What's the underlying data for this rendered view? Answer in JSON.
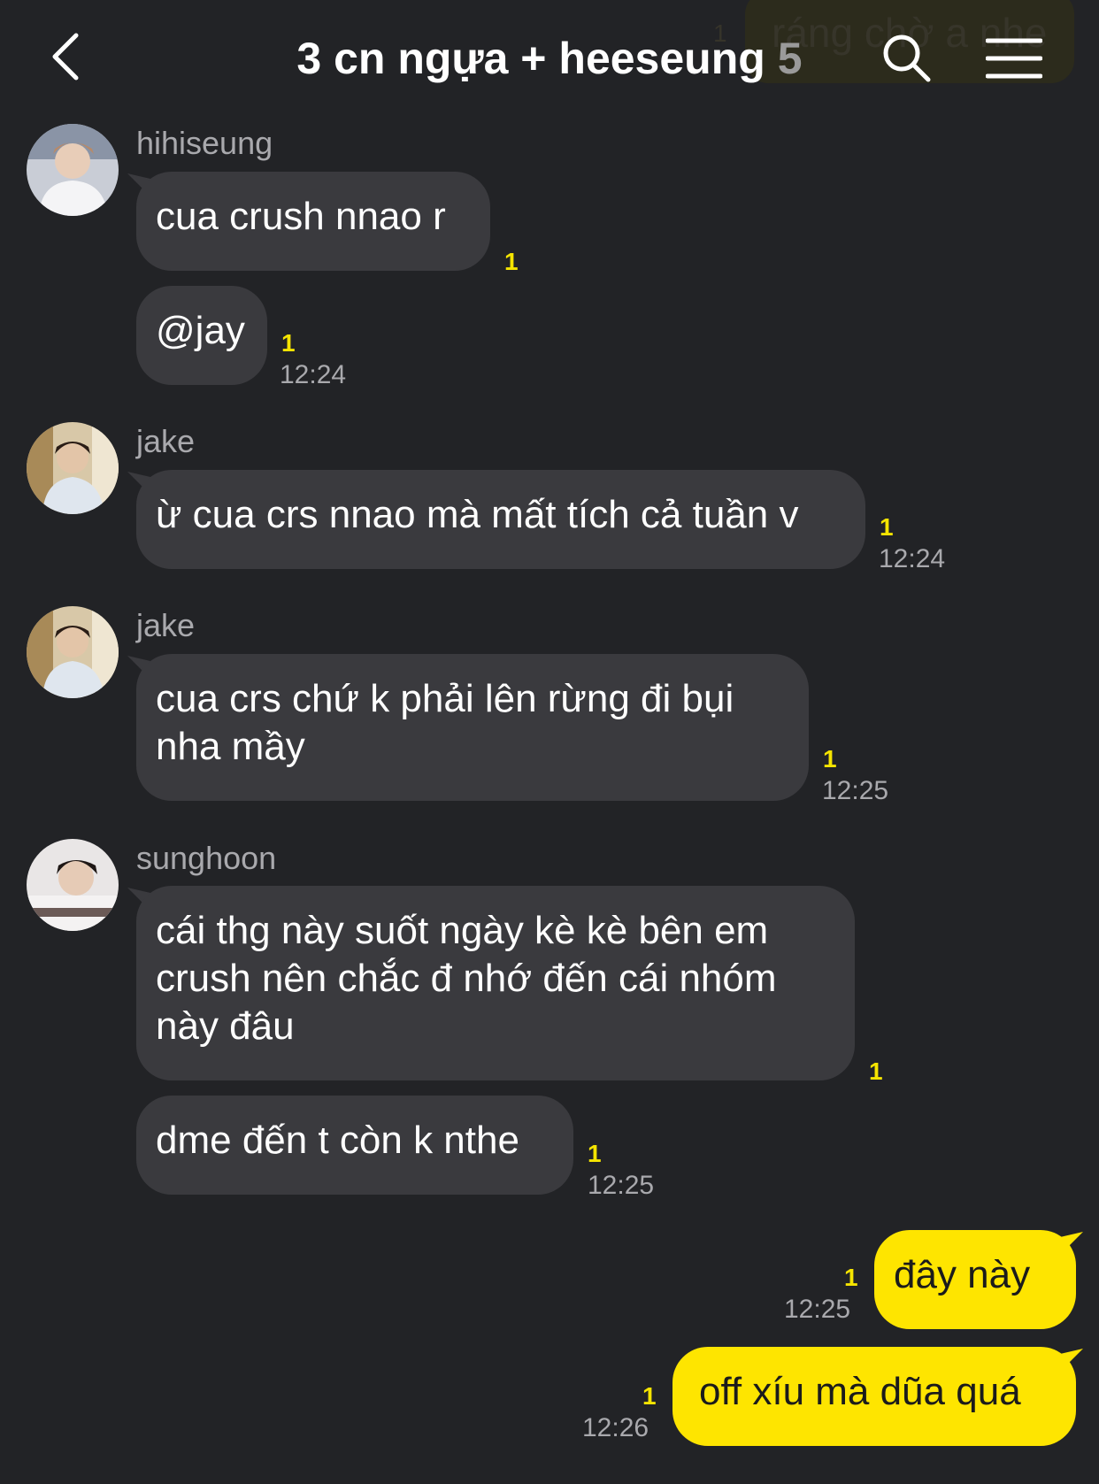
{
  "header": {
    "title": "3 cn ngựa + heeseung",
    "member_count": "5",
    "back_icon": "chevron-left-icon",
    "search_icon": "search-icon",
    "menu_icon": "hamburger-menu-icon"
  },
  "previous_message": {
    "text": "ráng chờ a nhe",
    "unread": "1"
  },
  "colors": {
    "background": "#222326",
    "bubble_other": "#3a3a3e",
    "bubble_mine": "#fee500",
    "unread": "#f5e400",
    "meta_text": "#a9a9ad"
  },
  "messages": [
    {
      "sender": "hihiseung",
      "bubbles": [
        {
          "text": "cua crush nnao r",
          "unread": "1",
          "time": ""
        },
        {
          "text": "@jay",
          "unread": "1",
          "time": "12:24"
        }
      ]
    },
    {
      "sender": "jake",
      "bubbles": [
        {
          "text": "ừ cua crs nnao mà mất tích cả tuần v",
          "unread": "1",
          "time": "12:24"
        }
      ]
    },
    {
      "sender": "jake",
      "bubbles": [
        {
          "line1": "cua crs chứ k phải lên rừng đi bụi",
          "line2": "nha mầy",
          "unread": "1",
          "time": "12:25"
        }
      ]
    },
    {
      "sender": "sunghoon",
      "bubbles": [
        {
          "line1": "cái thg này suốt ngày kè kè bên em",
          "line2": "crush nên chắc đ nhớ đến cái nhóm",
          "line3": "này đâu",
          "unread": "1",
          "time": ""
        },
        {
          "text": "dme đến t còn k nthe",
          "unread": "1",
          "time": "12:25"
        }
      ]
    },
    {
      "sender": "me",
      "bubbles": [
        {
          "text": "đây này",
          "unread": "1",
          "time": "12:25"
        },
        {
          "text": "off xíu mà dũa quá",
          "unread": "1",
          "time": "12:26"
        }
      ]
    }
  ]
}
